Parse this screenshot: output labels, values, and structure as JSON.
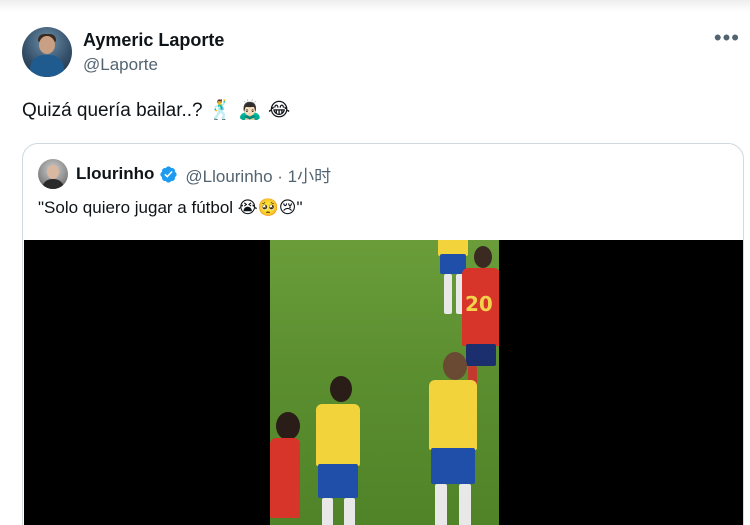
{
  "author": {
    "display_name": "Aymeric Laporte",
    "handle": "@Laporte"
  },
  "more_icon": "more-horizontal-icon",
  "tweet": {
    "text": "Quizá quería bailar..?",
    "emojis": [
      "🕺",
      "🙇🏻‍♂️",
      "😂"
    ]
  },
  "quoted_tweet": {
    "display_name": "Llourinho",
    "verified_icon": "verified-badge-icon",
    "handle_time": "@Llourinho · 1小时",
    "text": "\"Solo quiero jugar a fútbol 😭🥺😢\""
  },
  "colors": {
    "verified_blue": "#1d9bf0",
    "secondary_text": "#536471",
    "border": "#cfd9de"
  }
}
